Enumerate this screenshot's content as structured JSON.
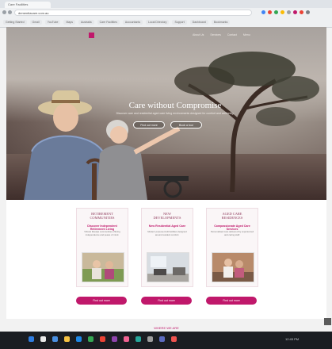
{
  "browser": {
    "tab_title": "Care Facilities",
    "address": "dementiacare.com.au",
    "bookmarks": [
      "Getting Started",
      "Gmail",
      "YouTube",
      "Maps",
      "Australia",
      "Care Facilities",
      "Accountants",
      "Local Directory",
      "Support",
      "Dashboard",
      "Bookmarks"
    ]
  },
  "hero": {
    "nav": [
      "About Us",
      "Services",
      "Contact",
      "Menu"
    ],
    "headline": "Care without Compromise",
    "subline": "Discover care and residential aged care living environments designed for comfort and wellbeing.",
    "buttons": [
      "Find out more",
      "Book a tour"
    ]
  },
  "cards": [
    {
      "title_line1": "RETIREMENT",
      "title_line2": "COMMUNITIES",
      "subtitle": "Discover Independent Retirement Living",
      "body": "Vibrant lifestyle communities offering independence and peace of mind."
    },
    {
      "title_line1": "NEW",
      "title_line2": "DEVELOPMENTS",
      "subtitle": "New Residential Aged Care",
      "body": "Modern purpose-built facilities designed around resident comfort."
    },
    {
      "title_line1": "AGED CARE",
      "title_line2": "RESIDENCES",
      "subtitle": "Compassionate Aged Care Services",
      "body": "Personalised care delivered by experienced and caring staff."
    }
  ],
  "cards_cta": [
    "Find out more",
    "Find out more",
    "Find out more"
  ],
  "section_heading": "WHERE WE ARE",
  "taskbar": {
    "tray_text": "12:45 PM"
  }
}
